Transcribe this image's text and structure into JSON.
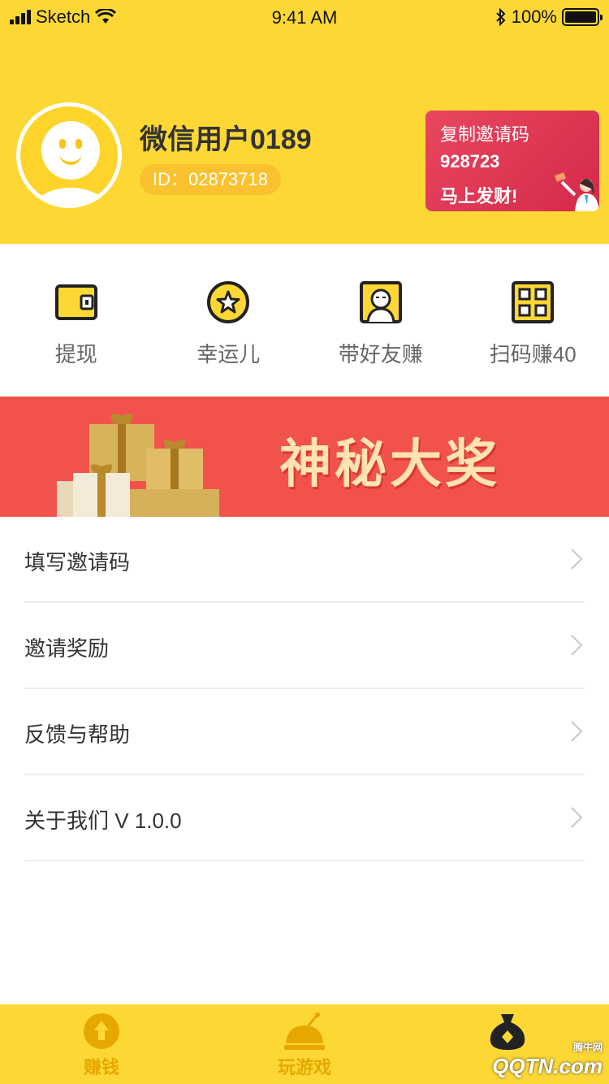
{
  "status_bar": {
    "carrier": "Sketch",
    "time": "9:41 AM",
    "battery": "100%"
  },
  "profile": {
    "name": "微信用户0189",
    "id_label": "ID：02873718"
  },
  "invite_card": {
    "line1": "复制邀请码",
    "code": "928723",
    "line3": "马上发财!"
  },
  "actions": [
    {
      "label": "提现",
      "icon": "wallet-icon"
    },
    {
      "label": "幸运儿",
      "icon": "star-icon"
    },
    {
      "label": "带好友赚",
      "icon": "friend-icon"
    },
    {
      "label": "扫码赚40",
      "icon": "qr-code-icon"
    }
  ],
  "banner": {
    "title": "神秘大奖"
  },
  "menu": [
    {
      "label": "填写邀请码"
    },
    {
      "label": "邀请奖励"
    },
    {
      "label": "反馈与帮助"
    },
    {
      "label": "关于我们 V 1.0.0"
    }
  ],
  "tabbar": [
    {
      "label": "赚钱",
      "icon": "money-icon"
    },
    {
      "label": "玩游戏",
      "icon": "game-icon"
    },
    {
      "label": "",
      "icon": "money-bag-icon"
    }
  ],
  "watermark": {
    "text": "QQTN.com",
    "small": "腾牛网"
  },
  "colors": {
    "primary": "#fdd835",
    "accent": "#e6a800",
    "invite_card": "#e0405a",
    "banner": "#f2524c"
  }
}
